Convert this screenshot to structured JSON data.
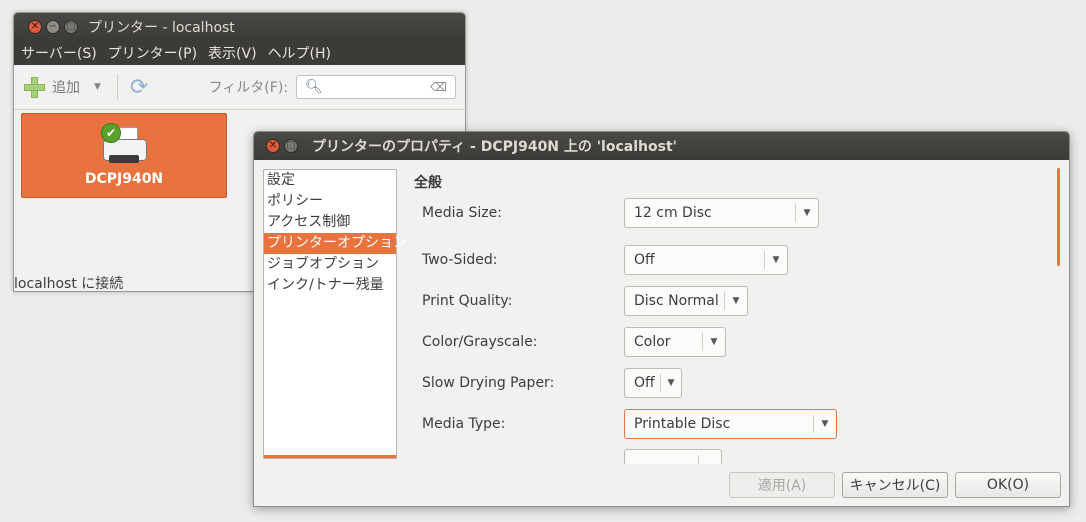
{
  "main_window": {
    "title": "プリンター - localhost",
    "menu": [
      "サーバー(S)",
      "プリンター(P)",
      "表示(V)",
      "ヘルプ(H)"
    ],
    "toolbar": {
      "add_label": "追加",
      "filter_label": "フィルタ(F):"
    },
    "printer": {
      "name": "DCPJ940N"
    },
    "status": "localhost に接続"
  },
  "dialog": {
    "title": "プリンターのプロパティ - DCPJ940N 上の 'localhost'",
    "sidebar": [
      {
        "label": "設定"
      },
      {
        "label": "ポリシー"
      },
      {
        "label": "アクセス制御"
      },
      {
        "label": "プリンターオプション",
        "selected": true
      },
      {
        "label": "ジョブオプション"
      },
      {
        "label": "インク/トナー残量"
      }
    ],
    "section_title": "全般",
    "options": [
      {
        "label": "Media Size:",
        "value": "12 cm Disc"
      },
      {
        "label": "Two-Sided:",
        "value": "Off"
      },
      {
        "label": "Print Quality:",
        "value": "Disc Normal"
      },
      {
        "label": "Color/Grayscale:",
        "value": "Color"
      },
      {
        "label": "Slow Drying Paper:",
        "value": "Off"
      },
      {
        "label": "Media Type:",
        "value": "Printable Disc"
      }
    ],
    "buttons": {
      "apply": "適用(A)",
      "cancel": "キャンセル(C)",
      "ok": "OK(O)"
    }
  },
  "colors": {
    "accent": "#e9733f",
    "titlebar": "#3c3b37",
    "window_bg": "#f2f1f0"
  }
}
